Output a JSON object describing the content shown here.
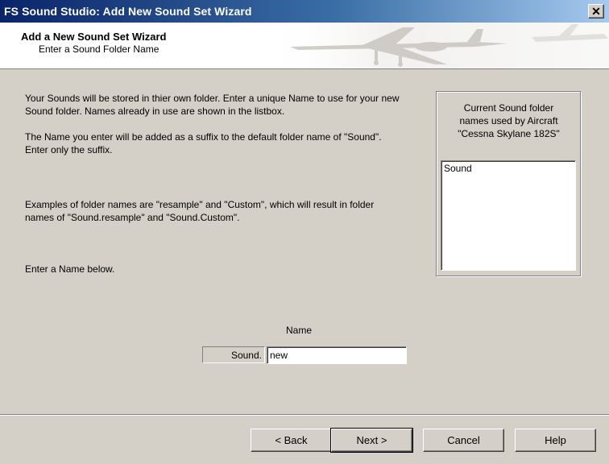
{
  "window": {
    "title": "FS Sound Studio: Add New Sound Set Wizard",
    "close_glyph": "✕"
  },
  "header": {
    "title": "Add a New Sound Set Wizard",
    "subtitle": "Enter a Sound Folder Name"
  },
  "body": {
    "paragraph1": "Your Sounds will be stored in thier own folder. Enter a unique Name to use for your new Sound folder. Names already in use are shown in the listbox.",
    "paragraph2": "The Name you enter will be added as a suffix to the default folder name of \"Sound\". Enter only the suffix.",
    "paragraph3": "Examples of folder names are \"resample\" and \"Custom\", which will result in folder names of \"Sound.resample\" and \"Sound.Custom\".",
    "paragraph4": "Enter a Name below."
  },
  "folder_group": {
    "label_line1": "Current Sound folder",
    "label_line2": "names used by Aircraft",
    "label_line3": "\"Cessna Skylane 182S\"",
    "items": [
      "Sound"
    ]
  },
  "name_entry": {
    "label": "Name",
    "prefix": "Sound.",
    "value": "new"
  },
  "buttons": {
    "back": "< Back",
    "next": "Next >",
    "cancel": "Cancel",
    "help": "Help"
  },
  "colors": {
    "title_gradient_start": "#0a246a",
    "title_gradient_end": "#a6caf0",
    "face": "#d4d0c8"
  }
}
